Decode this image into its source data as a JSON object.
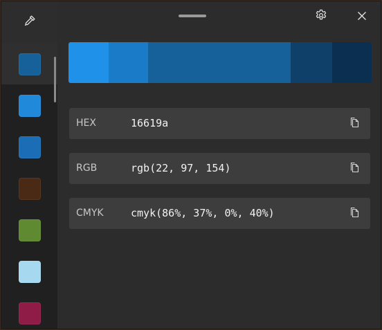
{
  "history": [
    {
      "color": "#16619a",
      "selected": true
    },
    {
      "color": "#2089da",
      "selected": false
    },
    {
      "color": "#1b6db5",
      "selected": false
    },
    {
      "color": "#4a2a14",
      "selected": false
    },
    {
      "color": "#5f8a32",
      "selected": false
    },
    {
      "color": "#a6d8ef",
      "selected": false
    },
    {
      "color": "#8e1c47",
      "selected": false
    }
  ],
  "gradient": [
    {
      "color": "#2091e9",
      "weight": 58
    },
    {
      "color": "#1a7bc9",
      "weight": 57
    },
    {
      "color": "#16619a",
      "weight": 206
    },
    {
      "color": "#0f406a",
      "weight": 60
    },
    {
      "color": "#0b2f50",
      "weight": 57
    }
  ],
  "formats": [
    {
      "label": "HEX",
      "value": "16619a"
    },
    {
      "label": "RGB",
      "value": "rgb(22, 97, 154)"
    },
    {
      "label": "CMYK",
      "value": "cmyk(86%, 37%, 0%, 40%)"
    }
  ],
  "icons": {
    "picker": "eyedropper-icon",
    "settings": "gear-icon",
    "close": "close-icon",
    "copy": "copy-icon"
  }
}
